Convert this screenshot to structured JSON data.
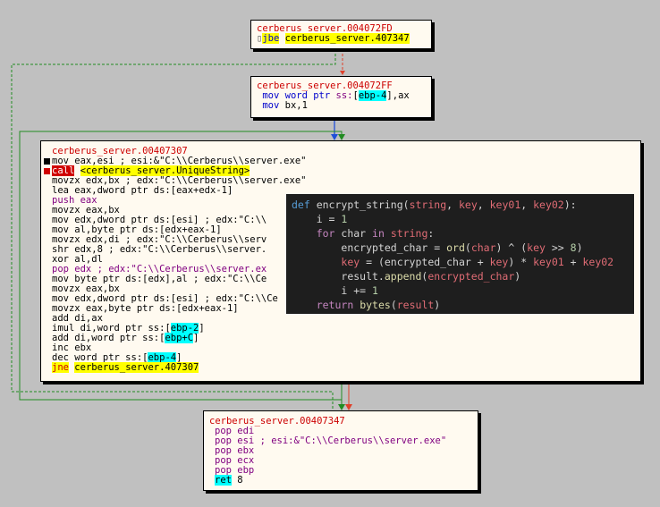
{
  "node1": {
    "title": "cerberus_server.004072FD",
    "lines": [
      {
        "mnem": "jbe",
        "target": "cerberus_server.407347"
      }
    ]
  },
  "node2": {
    "title": "cerberus_server.004072FF",
    "line1": {
      "mnem": "mov",
      "mid": " word ptr ",
      "seg": "ss:",
      "op": "ebp-4",
      "rest": ",ax"
    },
    "line2": {
      "mnem": "mov",
      "rest": " bx,1"
    }
  },
  "node3": {
    "title": "cerberus_server.00407307",
    "lines": [
      "mov eax,esi ; esi:&\"C:\\\\Cerberus\\\\server.exe\"",
      "call",
      "<cerberus_server.UniqueString>",
      "movzx edx,bx ; edx:\"C:\\\\Cerberus\\\\server.exe\"",
      "lea eax,dword ptr ds:[eax+edx-1]",
      "push eax",
      "movzx eax,bx",
      "mov edx,dword ptr ds:[esi] ; edx:\"C:\\\\",
      "mov al,byte ptr ds:[edx+eax-1]",
      "movzx edx,di ; edx:\"C:\\\\Cerberus\\\\serv",
      "shr edx,8 ; edx:\"C:\\\\Cerberus\\\\server.",
      "xor al,dl",
      "pop edx ; edx:\"C:\\\\Cerberus\\\\server.ex",
      "mov byte ptr ds:[edx],al ; edx:\"C:\\\\Ce",
      "movzx eax,bx",
      "mov edx,dword ptr ds:[esi] ; edx:\"C:\\\\Ce",
      "movzx eax,byte ptr ds:[edx+eax-1]",
      "add di,ax",
      "imul di,word ptr ss:",
      "ebp-2",
      "add di,word ptr ss:",
      "ebp+C",
      "inc ebx",
      "dec word ptr ss:",
      "ebp-4",
      "jne",
      "cerberus_server.407307"
    ]
  },
  "node4": {
    "title": "cerberus_server.00407347",
    "lines": [
      "pop edi",
      "pop esi ; esi:&\"C:\\\\Cerberus\\\\server.exe\"",
      "pop ebx",
      "pop ecx",
      "pop ebp",
      "ret",
      " 8"
    ]
  },
  "popup": {
    "l1_def": "def",
    "l1_name": " encrypt_string",
    "l1_open": "(",
    "p_string": "string",
    "p_key": "key",
    "p_key01": "key01",
    "p_key02": "key02",
    "l1_close": "):",
    "l2": "i = ",
    "l2_num": "1",
    "l3_for": "for",
    "l3_char": " char ",
    "l3_in": "in",
    "l3_str": "string",
    "l3_colon": ":",
    "l4": "encrypted_char = ",
    "l4_ord": "ord",
    "l4_char": "char",
    "l4_xor": ") ^ (",
    "l4_key": "key",
    "l4_shift": " >> ",
    "l4_num": "8",
    "l4_close": ")",
    "l5_key": "key",
    "l5_mid": " = (encrypted_char + ",
    "l5_key2": "key",
    "l5_mul": ") * ",
    "l5_k1": "key01",
    "l5_plus": " + ",
    "l5_k2": "key02",
    "l6_res": "result.",
    "l6_append": "append",
    "l6_arg": "encrypted_char",
    "l7": "i += ",
    "l7_num": "1",
    "l8_return": "return",
    "l8_bytes": "bytes",
    "l8_arg": "result"
  },
  "colors": {
    "background": "#c0c0c0",
    "node": "#fffaf0",
    "title": "#cc0000",
    "highlight_yellow": "#ffff00",
    "highlight_cyan": "#00ffff",
    "edge_green": "#228b22",
    "edge_red": "#e0402a",
    "edge_blue": "#1f4fd8",
    "popup_bg": "#1e1e1e"
  }
}
